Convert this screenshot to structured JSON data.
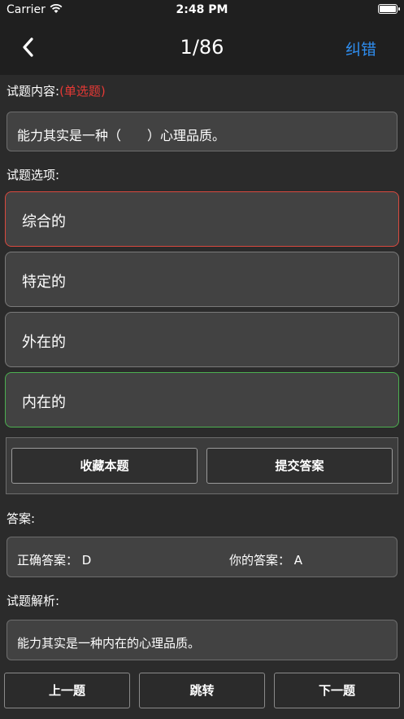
{
  "status": {
    "carrier": "Carrier",
    "time": "2:48 PM",
    "icons": [
      "wifi-icon",
      "battery-icon"
    ]
  },
  "nav": {
    "back_icon": "chevron-left-icon",
    "title": "1/86",
    "correct_label": "纠错",
    "accent_color": "#2f8ef0"
  },
  "question": {
    "label": "试题内容:",
    "type_tag": "(单选题)",
    "text": "能力其实是一种（　　）心理品质。"
  },
  "options": {
    "label": "试题选项:",
    "items": [
      {
        "text": "综合的",
        "state": "selected-wrong"
      },
      {
        "text": "特定的",
        "state": "normal"
      },
      {
        "text": "外在的",
        "state": "normal"
      },
      {
        "text": "内在的",
        "state": "correct"
      }
    ]
  },
  "actions": {
    "favorite_label": "收藏本题",
    "submit_label": "提交答案"
  },
  "answer": {
    "label": "答案:",
    "correct_text": "正确答案：  D",
    "yours_text": "你的答案：  A"
  },
  "analysis": {
    "label": "试题解析:",
    "text": "能力其实是一种内在的心理品质。"
  },
  "bottom": {
    "prev_label": "上一题",
    "jump_label": "跳转",
    "next_label": "下一题"
  },
  "colors": {
    "wrong": "#d9493f",
    "correct": "#4caf50",
    "tag": "#e53935"
  }
}
